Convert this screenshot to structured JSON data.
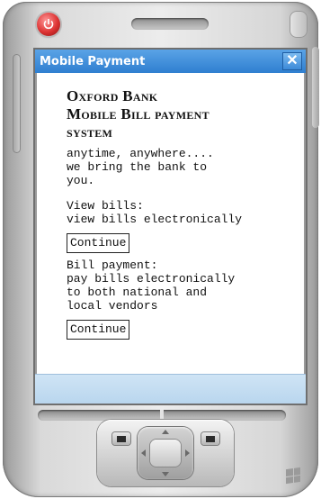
{
  "window": {
    "title": "Mobile Payment",
    "close_symbol": "✕"
  },
  "content": {
    "heading_line1": "Oxford Bank",
    "heading_line2": "Mobile Bill payment",
    "heading_line3": "system",
    "tagline": "anytime, anywhere....\nwe bring the bank to\nyou.",
    "view_bills": {
      "label": "View bills:",
      "description": "view bills electronically",
      "button_label": "Continue"
    },
    "bill_payment": {
      "label": "Bill payment:",
      "description": "pay bills electronically\nto both national and\nlocal vendors",
      "button_label": "Continue"
    }
  },
  "device": {
    "icons": [
      "power-icon",
      "speaker-grille",
      "calendar-key-icon",
      "contacts-key-icon",
      "windows-logo-icon"
    ]
  },
  "colors": {
    "title_bar": "#2f7fd0",
    "bottom_bar": "#b9d6ee",
    "power_button": "#d33333"
  }
}
